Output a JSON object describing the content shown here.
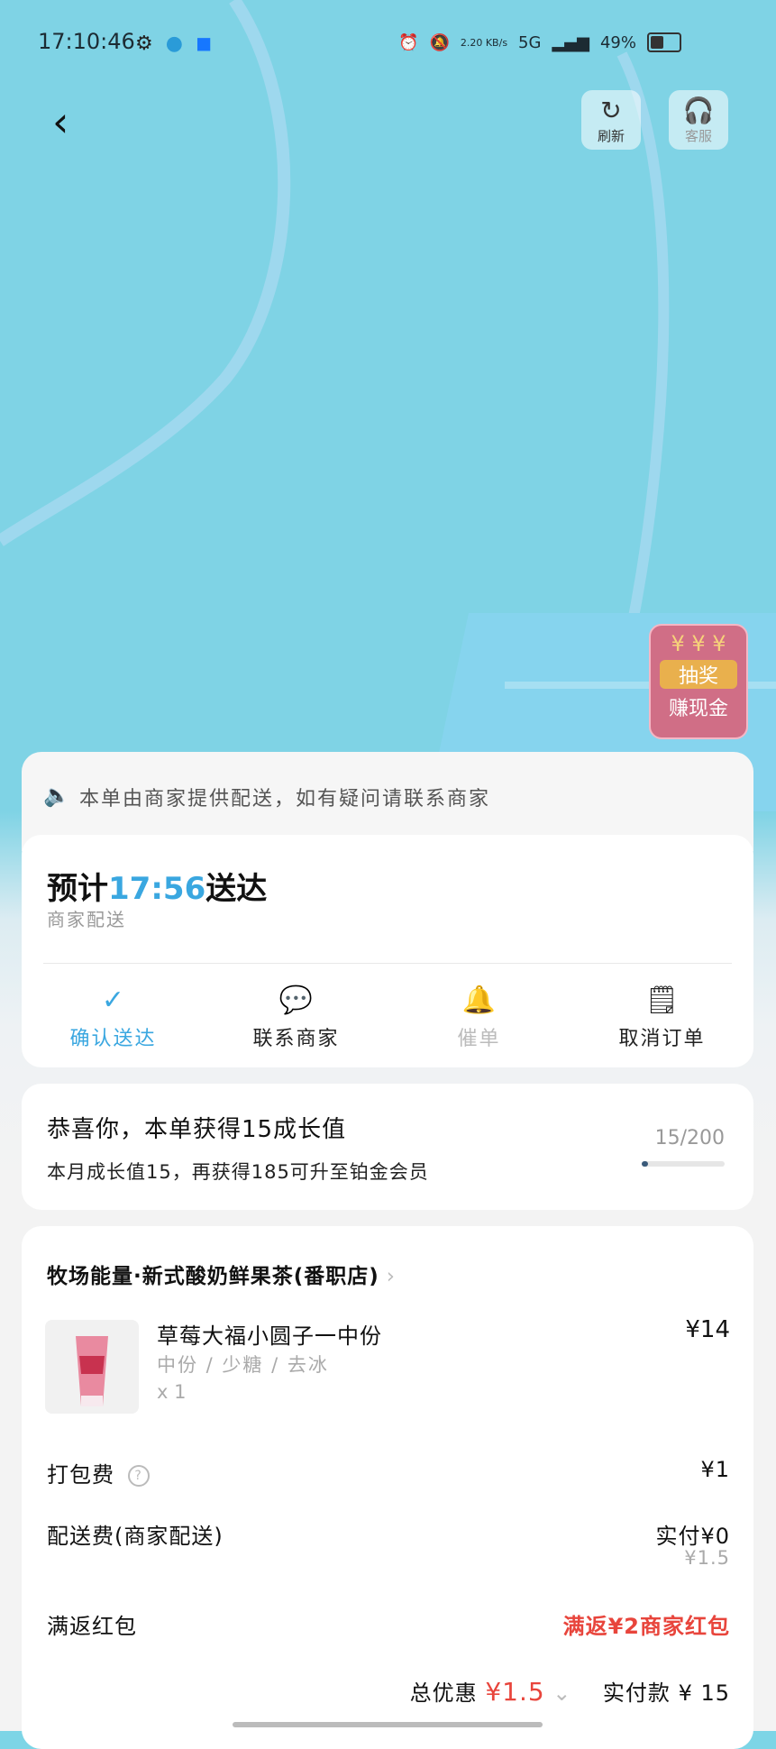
{
  "status_bar": {
    "time": "17:10:46",
    "speed": "2.20 KB/s",
    "network": "5G",
    "battery": "49%",
    "battery_level": 0.49
  },
  "header": {
    "refresh_label": "刷新",
    "service_label": "客服"
  },
  "lottery_badge": {
    "line1": "抽奖",
    "line2": "赚现金"
  },
  "notice": {
    "text": "本单由商家提供配送，如有疑问请联系商家"
  },
  "delivery": {
    "eta_prefix": "预计",
    "eta_time": "17:56",
    "eta_suffix": "送达",
    "mode": "商家配送",
    "actions": [
      {
        "label": "确认送达",
        "icon": "check-circle-icon",
        "color": "#3aa7e0"
      },
      {
        "label": "联系商家",
        "icon": "chat-icon",
        "color": "#222222"
      },
      {
        "label": "催单",
        "icon": "bell-icon",
        "color": "#bbbbbb"
      },
      {
        "label": "取消订单",
        "icon": "cancel-order-icon",
        "color": "#222222"
      }
    ]
  },
  "growth": {
    "headline": "恭喜你，本单获得15成长值",
    "detail": "本月成长值15，再获得185可升至铂金会员",
    "progress_text": "15/200",
    "progress": 0.075
  },
  "order": {
    "shop_name": "牧场能量·新式酸奶鲜果茶(番职店)",
    "item": {
      "name": "草莓大福小圆子一中份",
      "spec": "中份 / 少糖 / 去冰",
      "qty": "x 1",
      "price": "¥14"
    },
    "packing_fee": {
      "label": "打包费",
      "value": "¥1"
    },
    "delivery_fee": {
      "label": "配送费(商家配送)",
      "paid": "实付¥0",
      "original": "¥1.5"
    },
    "red_packet": {
      "label": "满返红包",
      "value": "满返¥2商家红包"
    },
    "total_discount_label": "总优惠",
    "total_discount": "¥1.5",
    "paid_label": "实付款",
    "paid": "¥ 15"
  },
  "colors": {
    "accent": "#3aa7e0",
    "red": "#e8453c",
    "map": "#7fd3e5"
  }
}
